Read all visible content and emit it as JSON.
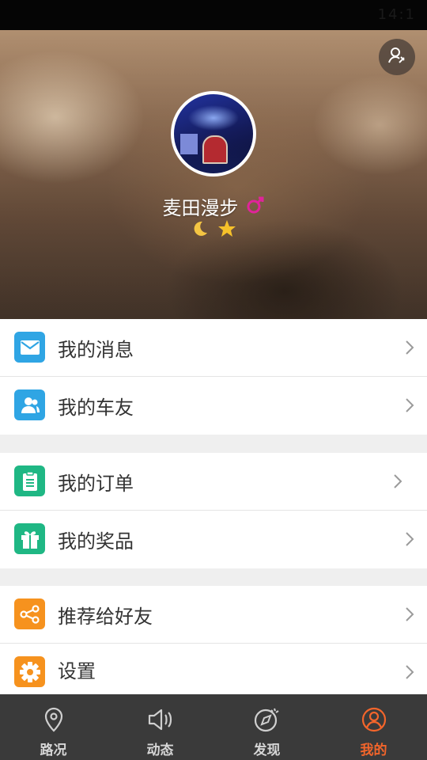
{
  "status_bar": {
    "right_text": "14:1"
  },
  "profile": {
    "username": "麦田漫步",
    "gender_icon": "male-symbol-icon",
    "level_icons": [
      "moon-icon",
      "star-icon"
    ],
    "profile_button_icon": "user-edit-icon"
  },
  "menu": {
    "group1": [
      {
        "label": "我的消息",
        "icon": "mail-icon",
        "color": "#2fa5e4"
      },
      {
        "label": "我的车友",
        "icon": "contacts-icon",
        "color": "#2fa5e4"
      }
    ],
    "group2": [
      {
        "label": "我的订单",
        "icon": "clipboard-icon",
        "color": "#1fb784"
      },
      {
        "label": "我的奖品",
        "icon": "gift-icon",
        "color": "#1fb784"
      }
    ],
    "group3": [
      {
        "label": "推荐给好友",
        "icon": "share-icon",
        "color": "#f6921e"
      },
      {
        "label": "设置",
        "icon": "gear-icon",
        "color": "#f6921e"
      }
    ]
  },
  "tabs": [
    {
      "label": "路况",
      "icon": "location-pin-icon",
      "active": false
    },
    {
      "label": "动态",
      "icon": "speaker-icon",
      "active": false
    },
    {
      "label": "发现",
      "icon": "compass-icon",
      "active": false
    },
    {
      "label": "我的",
      "icon": "user-circle-icon",
      "active": true
    }
  ],
  "colors": {
    "accent": "#f3652b",
    "tabbar_bg": "#3a3a3a"
  }
}
